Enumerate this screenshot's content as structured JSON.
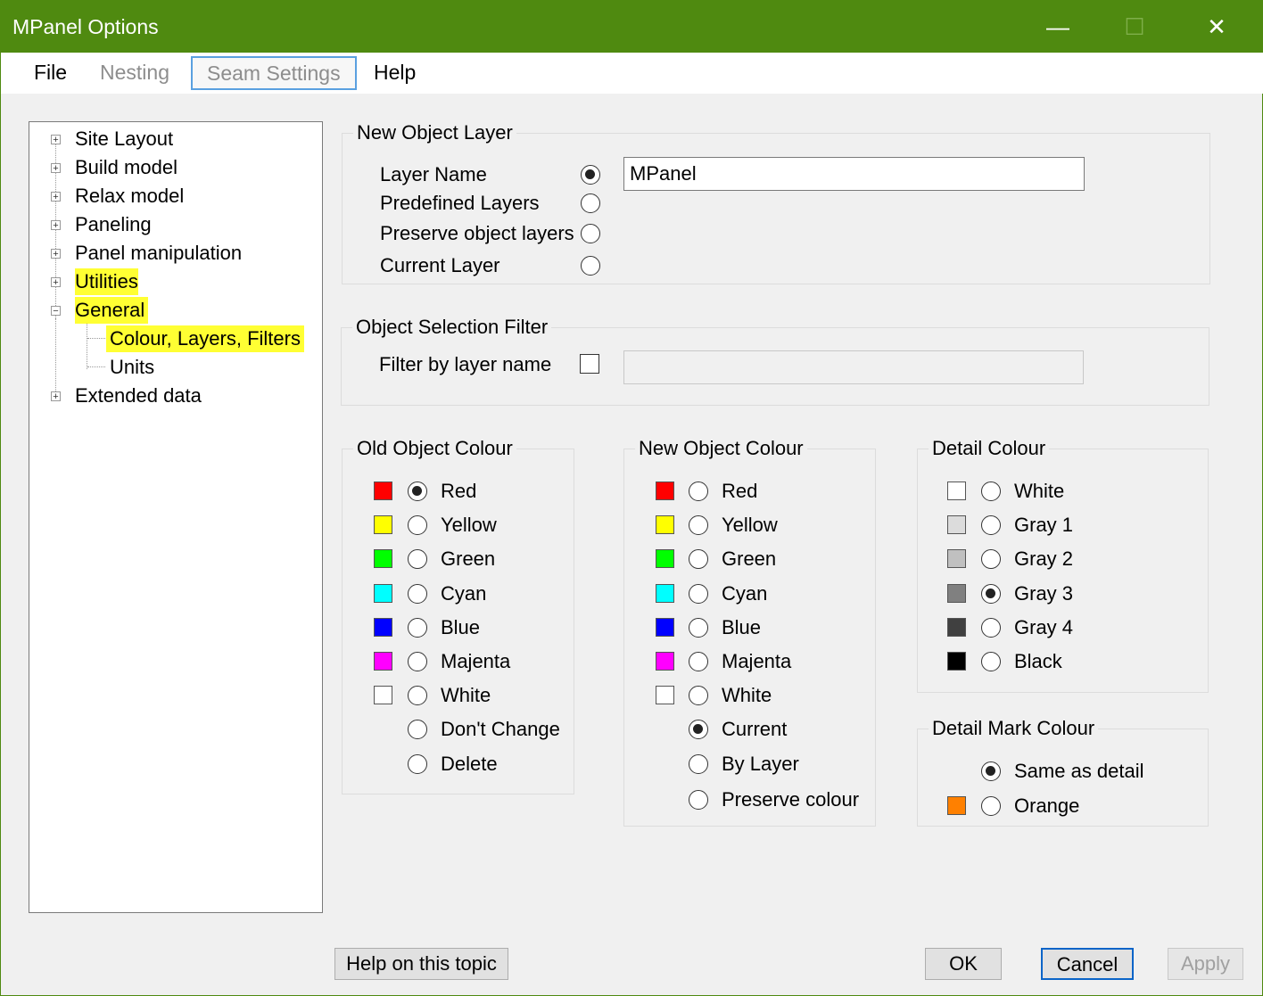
{
  "window": {
    "title": "MPanel Options"
  },
  "titlebar": {
    "minimize_icon": "minimize-icon",
    "maximize_icon": "maximize-icon",
    "close_icon": "close-icon",
    "min_glyph": "—",
    "max_glyph": "☐",
    "close_glyph": "✕"
  },
  "menu": {
    "file": "File",
    "nesting": "Nesting",
    "seam_settings": "Seam Settings",
    "help": "Help"
  },
  "tree": {
    "expander_plus": "+",
    "expander_minus": "−",
    "items": [
      {
        "label": "Site Layout"
      },
      {
        "label": "Build model"
      },
      {
        "label": "Relax model"
      },
      {
        "label": "Paneling"
      },
      {
        "label": "Panel manipulation"
      },
      {
        "label": "Utilities"
      },
      {
        "label": "General"
      },
      {
        "label": "Colour, Layers, Filters"
      },
      {
        "label": "Units"
      },
      {
        "label": "Extended data"
      }
    ],
    "highlight_color": "#ffff33"
  },
  "new_object_layer": {
    "title": "New Object Layer",
    "options": [
      "Layer Name",
      "Predefined Layers",
      "Preserve object layers",
      "Current Layer"
    ],
    "selected": "Layer Name",
    "layer_name_value": "MPanel"
  },
  "selection_filter": {
    "title": "Object Selection Filter",
    "label": "Filter by layer name",
    "checked": false,
    "value": ""
  },
  "old_colour": {
    "title": "Old Object Colour",
    "options": [
      "Red",
      "Yellow",
      "Green",
      "Cyan",
      "Blue",
      "Majenta",
      "White",
      "Don't Change",
      "Delete"
    ],
    "selected": "Red"
  },
  "new_colour": {
    "title": "New Object Colour",
    "options": [
      "Red",
      "Yellow",
      "Green",
      "Cyan",
      "Blue",
      "Majenta",
      "White",
      "Current",
      "By Layer",
      "Preserve colour"
    ],
    "selected": "Current"
  },
  "detail_colour": {
    "title": "Detail Colour",
    "options": [
      "White",
      "Gray 1",
      "Gray 2",
      "Gray 3",
      "Gray 4",
      "Black"
    ],
    "selected": "Gray 3"
  },
  "detail_mark_colour": {
    "title": "Detail Mark Colour",
    "options": [
      "Same as detail",
      "Orange"
    ],
    "selected": "Same as detail"
  },
  "colors": {
    "Red": "#ff0000",
    "Yellow": "#ffff00",
    "Green": "#00ff00",
    "Cyan": "#00ffff",
    "Blue": "#0000ff",
    "Majenta": "#ff00ff",
    "White": "#ffffff",
    "Gray 1": "#dcdcdc",
    "Gray 2": "#c0c0c0",
    "Gray 3": "#808080",
    "Gray 4": "#404040",
    "Black": "#000000",
    "Orange": "#ff8000",
    "titlebar": "#4f8a10",
    "accent": "#0a64c8"
  },
  "buttons": {
    "help": "Help on this topic",
    "ok": "OK",
    "cancel": "Cancel",
    "apply": "Apply"
  }
}
